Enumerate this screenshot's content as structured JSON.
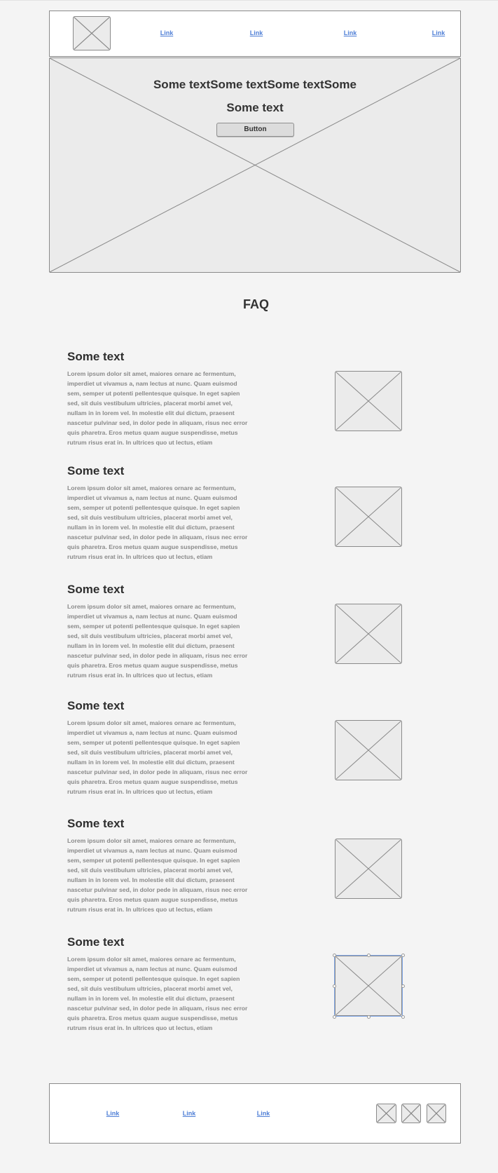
{
  "nav": {
    "links": [
      "Link",
      "Link",
      "Link",
      "Link"
    ],
    "logo_icon": "image-placeholder-icon"
  },
  "hero": {
    "title_line1": "Some textSome textSome textSome",
    "title_line2": "Some text",
    "button_label": "Button"
  },
  "faq": {
    "title": "FAQ",
    "items": [
      {
        "heading": "Some text"
      },
      {
        "heading": "Some text"
      },
      {
        "heading": "Some text"
      },
      {
        "heading": "Some text"
      },
      {
        "heading": "Some text"
      },
      {
        "heading": "Some text"
      }
    ],
    "paragraph_lines": [
      "Lorem ipsum dolor sit amet, maiores ornare ac fermentum,",
      "imperdiet ut vivamus a, nam lectus at nunc. Quam euismod",
      "sem, semper ut potenti pellentesque quisque. In eget sapien",
      "sed, sit duis vestibulum ultricies, placerat morbi amet vel,",
      "nullam in in lorem vel. In molestie elit dui dictum, praesent",
      "nascetur pulvinar sed, in dolor pede in aliquam, risus nec error",
      "quis pharetra. Eros metus quam augue suspendisse, metus",
      "rutrum risus erat in.  In ultrices quo ut lectus, etiam"
    ]
  },
  "footer": {
    "links": [
      "Link",
      "Link",
      "Link"
    ]
  },
  "colors": {
    "link": "#4f7fd6",
    "selection": "#7fa7e8",
    "placeholder_bg": "#ebebeb",
    "page_bg": "#f4f4f4"
  }
}
